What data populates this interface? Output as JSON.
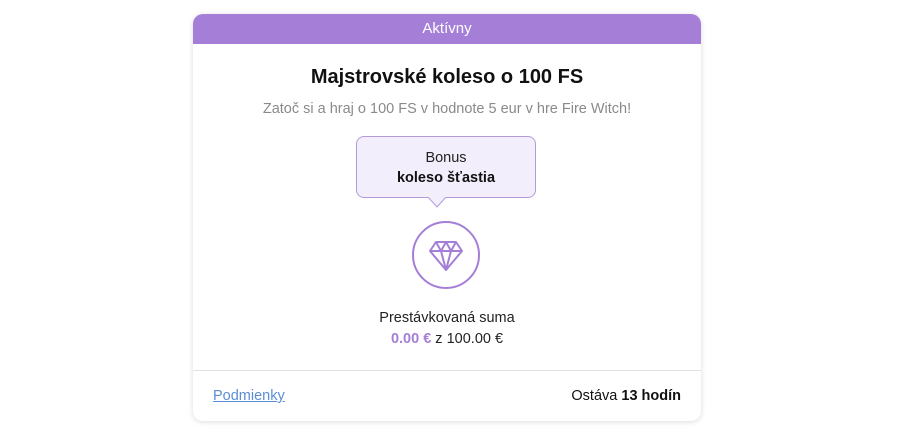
{
  "card": {
    "status_label": "Aktívny",
    "title": "Majstrovské koleso o 100 FS",
    "subtitle": "Zatoč si a hraj o 100 FS v hodnote 5 eur v hre Fire Witch!",
    "bonus": {
      "line1": "Bonus",
      "line2": "koleso šťastia"
    },
    "icon": "diamond-icon",
    "progress": {
      "label": "Prestávkovaná suma",
      "current": "0.00 €",
      "separator": " z ",
      "total": "100.00 €"
    },
    "footer": {
      "terms_label": "Podmienky",
      "remaining_prefix": "Ostáva ",
      "remaining_value": "13 hodín"
    }
  },
  "colors": {
    "accent": "#a57fd7",
    "link": "#5b8ed6",
    "bubble_bg": "#f3eefc"
  }
}
